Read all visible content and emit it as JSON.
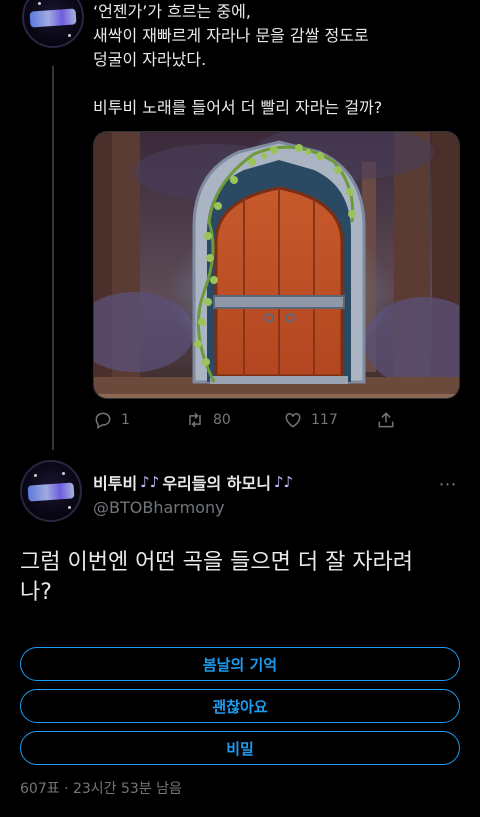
{
  "previous_tweet": {
    "lines": [
      "‘언젠가’가 흐르는 중에,",
      "새싹이 재빠르게 자라나 문을 감쌀 정도로",
      "덩굴이 자라났다.",
      "비투비 노래를 들어서 더 빨리 자라는 걸까?"
    ],
    "image_alt": "vine-covered wooden door illustration",
    "actions": {
      "reply_count": "1",
      "retweet_count": "80",
      "like_count": "117"
    }
  },
  "tweet": {
    "display_name": "비투비 ",
    "display_name_main": "우리들의 하모니",
    "name_emoji": "♪♪",
    "handle": "@BTOBharmony",
    "more_icon": "⋯",
    "text": "그럼 이번엔 어떤 곡을 들으면 더 잘 자라려나?",
    "text_lines": [
      "그럼 이번엔 어떤 곡을 들으면 더 잘 자라려",
      "나?"
    ],
    "poll": {
      "options": [
        "봄날의 기억",
        "괜찮아요",
        "비밀"
      ],
      "meta": "607표 · 23시간 53분 남음"
    }
  },
  "colors": {
    "background": "#000000",
    "text": "#e7e9ea",
    "muted": "#71767b",
    "accent": "#1d9bf0"
  },
  "icons": [
    "reply-icon",
    "retweet-icon",
    "like-icon",
    "share-icon",
    "more-icon"
  ]
}
